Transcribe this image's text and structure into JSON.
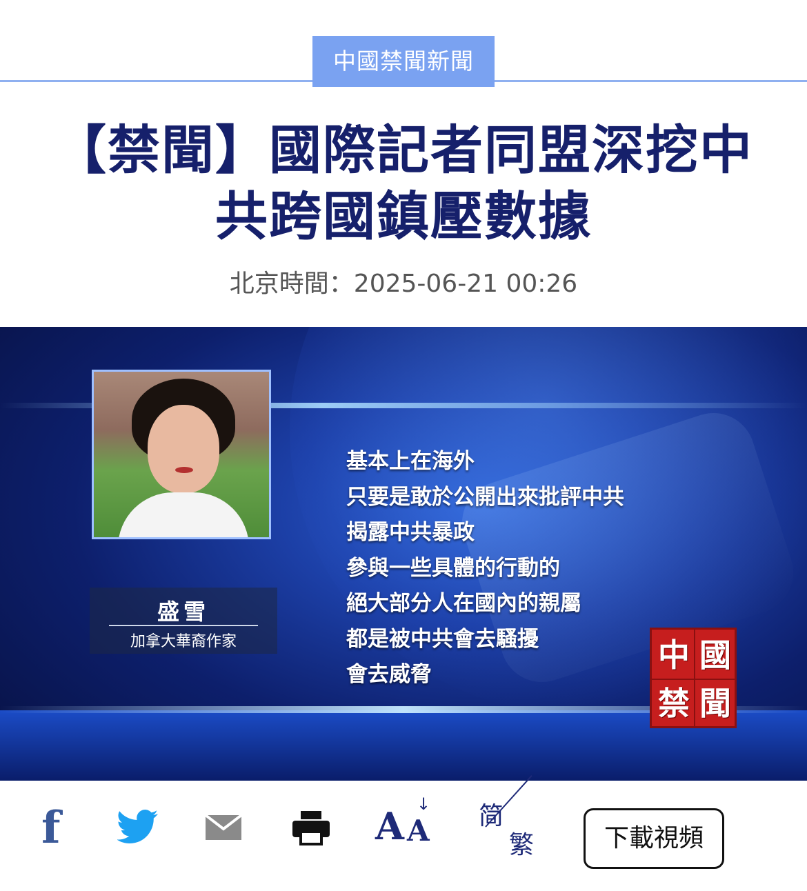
{
  "header": {
    "category": "中國禁聞新聞"
  },
  "article": {
    "title": "【禁聞】國際記者同盟深挖中共跨國鎮壓數據",
    "date": "北京時間：2025-06-21 00:26"
  },
  "video": {
    "person_name": "盛雪",
    "person_role": "加拿大華裔作家",
    "quote_lines": [
      "基本上在海外",
      "只要是敢於公開出來批評中共",
      "揭露中共暴政",
      "參與一些具體的行動的",
      "絕大部分人在國內的親屬",
      "都是被中共會去騷擾",
      "會去威脅"
    ],
    "logo_chars": [
      "中",
      "國",
      "禁",
      "聞"
    ]
  },
  "toolbar": {
    "facebook_glyph": "f",
    "font_size_glyph_a1": "A",
    "font_size_glyph_a2": "A",
    "simplified": "简",
    "traditional": "繁",
    "download_label": "下載視頻"
  },
  "colors": {
    "accent": "#7aa2f1",
    "title": "#16206b",
    "facebook": "#3b5998",
    "twitter": "#1da1f2"
  }
}
